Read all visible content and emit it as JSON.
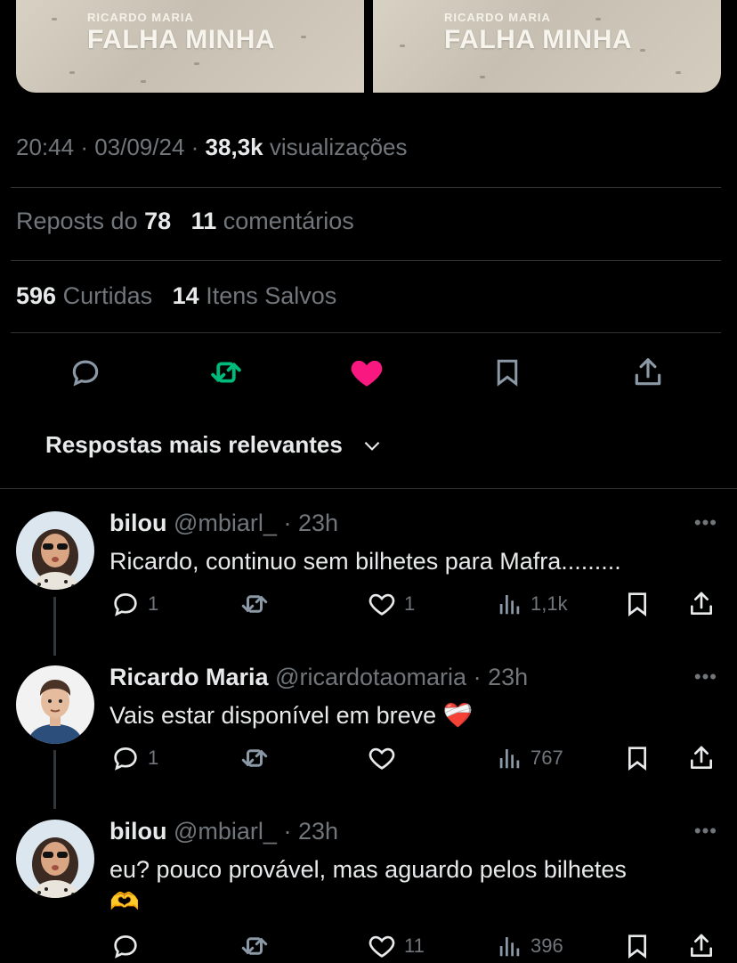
{
  "media": [
    {
      "author": "RICARDO MARIA",
      "title": "FALHA MINHA"
    },
    {
      "author": "RICARDO MARIA",
      "title": "FALHA MINHA"
    }
  ],
  "tweet_meta": {
    "time": "20:44",
    "date": "03/09/24",
    "views": "38,3k",
    "views_label": "visualizações"
  },
  "stats": {
    "reposts_label": "Reposts do",
    "reposts": "78",
    "comments": "11",
    "comments_label": "comentários",
    "likes": "596",
    "likes_label": "Curtidas",
    "saves": "14",
    "saves_label": "Itens Salvos"
  },
  "actions": [
    {
      "icon": "reply-icon"
    },
    {
      "icon": "repost-icon",
      "color": "#00ba7c"
    },
    {
      "icon": "like-icon",
      "color": "#f91880"
    },
    {
      "icon": "bookmark-icon"
    },
    {
      "icon": "share-icon"
    }
  ],
  "sort": {
    "label": "Respostas mais relevantes"
  },
  "replies": [
    {
      "name": "bilou",
      "handle": "@mbiarl_",
      "time": "23h",
      "text": "Ricardo, continuo sem bilhetes para Mafra.........",
      "emoji": "",
      "replies": "1",
      "reposts": "",
      "likes": "1",
      "views": "1,1k"
    },
    {
      "name": "Ricardo Maria",
      "handle": "@ricardotaomaria",
      "time": "23h",
      "text": "Vais estar disponível em breve",
      "emoji": "❤️‍🩹",
      "replies": "1",
      "reposts": "",
      "likes": "",
      "views": "767"
    },
    {
      "name": "bilou",
      "handle": "@mbiarl_",
      "time": "23h",
      "text": "eu? pouco provável, mas aguardo pelos bilhetes",
      "emoji": "🫶",
      "replies": "",
      "reposts": "",
      "likes": "11",
      "views": "396"
    }
  ],
  "colors": {
    "background": "#000000",
    "muted": "#71767b",
    "text": "#e7e9ea",
    "repost": "#00ba7c",
    "like": "#f91880",
    "divider": "#2f3336"
  }
}
